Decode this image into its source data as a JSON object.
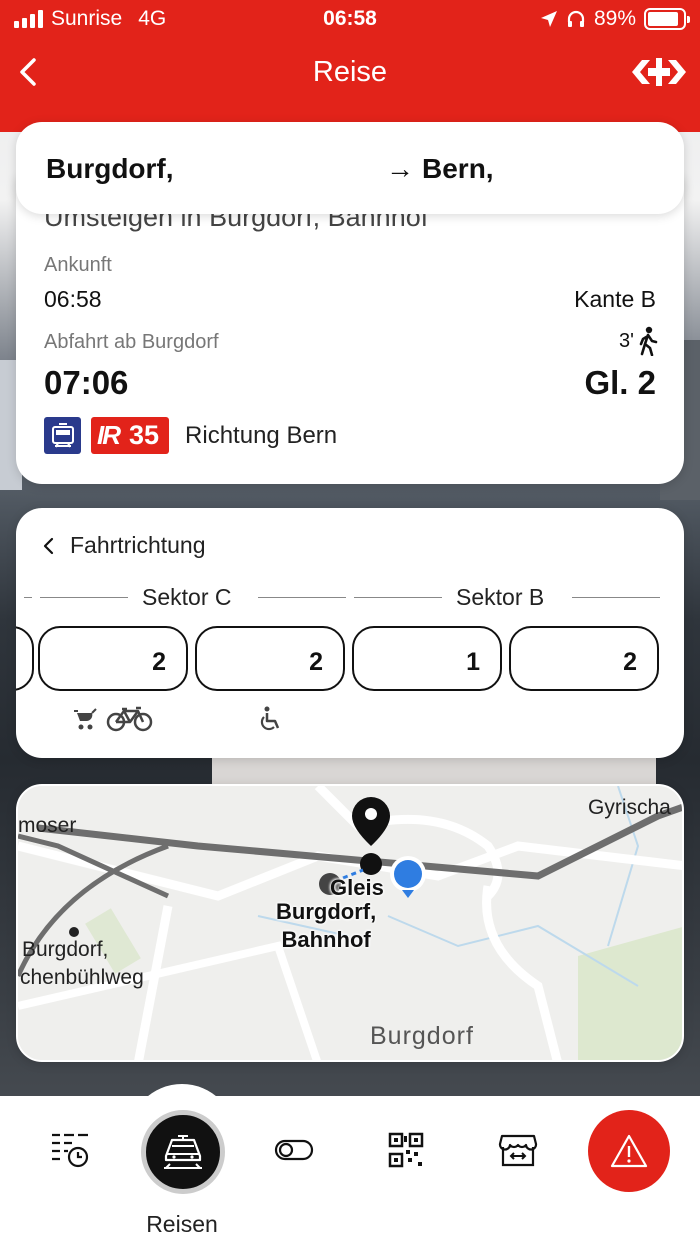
{
  "status_bar": {
    "carrier": "Sunrise",
    "network": "4G",
    "time": "06:58",
    "battery": "89%"
  },
  "nav": {
    "title": "Reise",
    "back_icon": "chevron-left-icon",
    "logo_icon": "sbb-logo-icon"
  },
  "route": {
    "from": "Burgdorf,",
    "arrow": "→",
    "to": "Bern,"
  },
  "connection": {
    "transfer_text": "Umsteigen in Burgdorf, Bahnhof",
    "arrival_label": "Ankunft",
    "arrival_time": "06:58",
    "arrival_platform": "Kante B",
    "departure_label": "Abfahrt ab Burgdorf",
    "departure_time": "07:06",
    "transfer_minutes": "3'",
    "departure_platform": "Gl. 2",
    "product_line": "IR",
    "product_number": "35",
    "direction": "Richtung Bern"
  },
  "formation": {
    "direction_label": "Fahrtrichtung",
    "sectors": [
      "Sektor C",
      "Sektor B"
    ],
    "wagons": [
      {
        "class": "2"
      },
      {
        "class": "2"
      },
      {
        "class": "1"
      },
      {
        "class": "2"
      }
    ],
    "wagon_icons": [
      "stroller-icon",
      "bicycle-icon",
      "wheelchair-icon"
    ]
  },
  "map": {
    "labels": {
      "gyrischachen": "Gyrischa",
      "moser": "moser",
      "gleis": "Gleis",
      "station": "Burgdorf,\nBahnhof",
      "stop": "Burgdorf,",
      "stop2": "chenbühlweg",
      "town": "Burgdorf"
    }
  },
  "tabbar": {
    "active_label": "Reisen",
    "tabs": [
      "timetable-icon",
      "train-icon",
      "toggle-icon",
      "qr-code-icon",
      "shop-icon",
      "warning-icon"
    ]
  },
  "colors": {
    "brand_red": "#e2231a",
    "product_blue": "#2a3a8c",
    "location_blue": "#2f7de1"
  }
}
